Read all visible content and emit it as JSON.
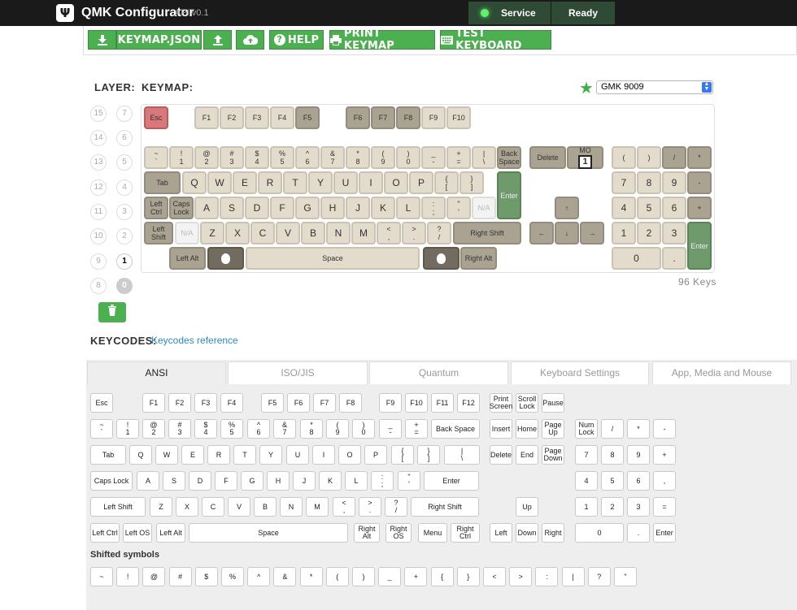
{
  "app": {
    "title": "QMK Configurator",
    "api": "API v0.1",
    "service": "Service",
    "status": "Ready"
  },
  "toolbar": {
    "keymap_json": "KEYMAP.JSON",
    "help": "HELP",
    "print": "PRINT KEYMAP",
    "test": "TEST KEYBOARD"
  },
  "labels": {
    "layer": "LAYER:",
    "keymap": "KEYMAP:",
    "keycodes": "KEYCODES:",
    "keycodes_link": "Keycodes reference",
    "keys_count": "96 Keys",
    "shifted": "Shifted symbols"
  },
  "colorway": {
    "selected": "GMK 9009"
  },
  "layers": [
    "15",
    "14",
    "13",
    "12",
    "11",
    "10",
    "9",
    "8",
    "7",
    "6",
    "5",
    "4",
    "3",
    "2",
    "1",
    "0"
  ],
  "keymap_keys": [
    {
      "t": "Esc",
      "c": "r"
    },
    {
      "t": "F1",
      "c": "a"
    },
    {
      "t": "F2",
      "c": "a"
    },
    {
      "t": "F3",
      "c": "a"
    },
    {
      "t": "F4",
      "c": "a"
    },
    {
      "t": "F5",
      "c": "m"
    },
    {
      "t": "F6",
      "c": "m"
    },
    {
      "t": "F7",
      "c": "m"
    },
    {
      "t": "F8",
      "c": "m"
    },
    {
      "t": "F9",
      "c": "a"
    },
    {
      "t": "F10",
      "c": "a"
    },
    {
      "t": "~",
      "s": "`",
      "c": "a"
    },
    {
      "t": "!",
      "s": "1",
      "c": "a"
    },
    {
      "t": "@",
      "s": "2",
      "c": "a"
    },
    {
      "t": "#",
      "s": "3",
      "c": "a"
    },
    {
      "t": "$",
      "s": "4",
      "c": "a"
    },
    {
      "t": "%",
      "s": "5",
      "c": "a"
    },
    {
      "t": "^",
      "s": "6",
      "c": "a"
    },
    {
      "t": "&",
      "s": "7",
      "c": "a"
    },
    {
      "t": "*",
      "s": "8",
      "c": "a"
    },
    {
      "t": "(",
      "s": "9",
      "c": "a"
    },
    {
      "t": ")",
      "s": "0",
      "c": "a"
    },
    {
      "t": "_",
      "s": "-",
      "c": "a"
    },
    {
      "t": "+",
      "s": "=",
      "c": "a"
    },
    {
      "t": "|",
      "s": "\\",
      "c": "a"
    },
    {
      "t": "Back",
      "s": "Space",
      "c": "m"
    },
    {
      "t": "Delete",
      "c": "m"
    },
    {
      "t": "MO",
      "s": "1",
      "c": "m",
      "mo": true
    },
    {
      "t": "(",
      "c": "a"
    },
    {
      "t": ")",
      "c": "a"
    },
    {
      "t": "/",
      "c": "m"
    },
    {
      "t": "*",
      "c": "m"
    },
    {
      "t": "Tab",
      "c": "m"
    },
    {
      "t": "Q",
      "c": "a",
      "b": 1
    },
    {
      "t": "W",
      "c": "a",
      "b": 1
    },
    {
      "t": "E",
      "c": "a",
      "b": 1
    },
    {
      "t": "R",
      "c": "a",
      "b": 1
    },
    {
      "t": "T",
      "c": "a",
      "b": 1
    },
    {
      "t": "Y",
      "c": "a",
      "b": 1
    },
    {
      "t": "U",
      "c": "a",
      "b": 1
    },
    {
      "t": "I",
      "c": "a",
      "b": 1
    },
    {
      "t": "O",
      "c": "a",
      "b": 1
    },
    {
      "t": "P",
      "c": "a",
      "b": 1
    },
    {
      "t": "{",
      "s": "[",
      "c": "a"
    },
    {
      "t": "}",
      "s": "]",
      "c": "a"
    },
    {
      "t": "Enter",
      "c": "g"
    },
    {
      "t": "7",
      "c": "a",
      "b": 1
    },
    {
      "t": "8",
      "c": "a",
      "b": 1
    },
    {
      "t": "9",
      "c": "a",
      "b": 1
    },
    {
      "t": "-",
      "c": "m",
      "b": 1
    },
    {
      "t": "Left",
      "s": "Ctrl",
      "c": "m"
    },
    {
      "t": "Caps",
      "s": "Lock",
      "c": "m"
    },
    {
      "t": "A",
      "c": "a",
      "b": 1
    },
    {
      "t": "S",
      "c": "a",
      "b": 1
    },
    {
      "t": "D",
      "c": "a",
      "b": 1
    },
    {
      "t": "F",
      "c": "a",
      "b": 1
    },
    {
      "t": "G",
      "c": "a",
      "b": 1
    },
    {
      "t": "H",
      "c": "a",
      "b": 1
    },
    {
      "t": "J",
      "c": "a",
      "b": 1
    },
    {
      "t": "K",
      "c": "a",
      "b": 1
    },
    {
      "t": "L",
      "c": "a",
      "b": 1
    },
    {
      "t": ":",
      "s": ";",
      "c": "a"
    },
    {
      "t": "\"",
      "s": "'",
      "c": "a"
    },
    {
      "t": "N/A",
      "c": "n"
    },
    {
      "t": "↑",
      "c": "m",
      "b": 1
    },
    {
      "t": "4",
      "c": "a",
      "b": 1
    },
    {
      "t": "5",
      "c": "a",
      "b": 1
    },
    {
      "t": "6",
      "c": "a",
      "b": 1
    },
    {
      "t": "+",
      "c": "m",
      "b": 1
    },
    {
      "t": "Left",
      "s": "Shift",
      "c": "m"
    },
    {
      "t": "N/A",
      "c": "n"
    },
    {
      "t": "Z",
      "c": "a",
      "b": 1
    },
    {
      "t": "X",
      "c": "a",
      "b": 1
    },
    {
      "t": "C",
      "c": "a",
      "b": 1
    },
    {
      "t": "V",
      "c": "a",
      "b": 1
    },
    {
      "t": "B",
      "c": "a",
      "b": 1
    },
    {
      "t": "N",
      "c": "a",
      "b": 1
    },
    {
      "t": "M",
      "c": "a",
      "b": 1
    },
    {
      "t": "<",
      "s": ",",
      "c": "a"
    },
    {
      "t": ">",
      "s": ".",
      "c": "a"
    },
    {
      "t": "?",
      "s": "/",
      "c": "a"
    },
    {
      "t": "Right Shift",
      "c": "m"
    },
    {
      "t": "←",
      "c": "m",
      "b": 1
    },
    {
      "t": "↓",
      "c": "m",
      "b": 1
    },
    {
      "t": "→",
      "c": "m",
      "b": 1
    },
    {
      "t": "1",
      "c": "a",
      "b": 1
    },
    {
      "t": "2",
      "c": "a",
      "b": 1
    },
    {
      "t": "3",
      "c": "a",
      "b": 1
    },
    {
      "t": "Enter",
      "c": "g"
    },
    {
      "t": "Left Alt",
      "c": "m"
    },
    {
      "t": "",
      "c": "d",
      "apple": true
    },
    {
      "t": "Space",
      "c": "a"
    },
    {
      "t": "",
      "c": "d",
      "apple": true
    },
    {
      "t": "Right Alt",
      "c": "m"
    },
    {
      "t": "0",
      "c": "a",
      "b": 1
    },
    {
      "t": ".",
      "c": "a",
      "b": 1
    }
  ],
  "tabs": [
    "ANSI",
    "ISO/JIS",
    "Quantum",
    "Keyboard Settings",
    "App, Media and Mouse"
  ],
  "keycodes": [
    {
      "t": "Esc"
    },
    {
      "t": "F1"
    },
    {
      "t": "F2"
    },
    {
      "t": "F3"
    },
    {
      "t": "F4"
    },
    {
      "t": "F5"
    },
    {
      "t": "F6"
    },
    {
      "t": "F7"
    },
    {
      "t": "F8"
    },
    {
      "t": "F9"
    },
    {
      "t": "F10"
    },
    {
      "t": "F11"
    },
    {
      "t": "F12"
    },
    {
      "t": "Print",
      "s": "Screen"
    },
    {
      "t": "Scroll",
      "s": "Lock"
    },
    {
      "t": "Pause"
    },
    {
      "t": "~",
      "s": "`"
    },
    {
      "t": "!",
      "s": "1"
    },
    {
      "t": "@",
      "s": "2"
    },
    {
      "t": "#",
      "s": "3"
    },
    {
      "t": "$",
      "s": "4"
    },
    {
      "t": "%",
      "s": "5"
    },
    {
      "t": "^",
      "s": "6"
    },
    {
      "t": "&",
      "s": "7"
    },
    {
      "t": "*",
      "s": "8"
    },
    {
      "t": "(",
      "s": "9"
    },
    {
      "t": ")",
      "s": "0"
    },
    {
      "t": "_",
      "s": "-"
    },
    {
      "t": "+",
      "s": "="
    },
    {
      "t": "Back Space"
    },
    {
      "t": "Insert"
    },
    {
      "t": "Home"
    },
    {
      "t": "Page",
      "s": "Up"
    },
    {
      "t": "Num",
      "s": "Lock"
    },
    {
      "t": "/"
    },
    {
      "t": "*"
    },
    {
      "t": "-"
    },
    {
      "t": "Tab"
    },
    {
      "t": "Q"
    },
    {
      "t": "W"
    },
    {
      "t": "E"
    },
    {
      "t": "R"
    },
    {
      "t": "T"
    },
    {
      "t": "Y"
    },
    {
      "t": "U"
    },
    {
      "t": "I"
    },
    {
      "t": "O"
    },
    {
      "t": "P"
    },
    {
      "t": "{",
      "s": "["
    },
    {
      "t": "}",
      "s": "]"
    },
    {
      "t": "|",
      "s": "\\"
    },
    {
      "t": "Delete"
    },
    {
      "t": "End"
    },
    {
      "t": "Page",
      "s": "Down"
    },
    {
      "t": "7"
    },
    {
      "t": "8"
    },
    {
      "t": "9"
    },
    {
      "t": "+"
    },
    {
      "t": "Caps Lock"
    },
    {
      "t": "A"
    },
    {
      "t": "S"
    },
    {
      "t": "D"
    },
    {
      "t": "F"
    },
    {
      "t": "G"
    },
    {
      "t": "H"
    },
    {
      "t": "J"
    },
    {
      "t": "K"
    },
    {
      "t": "L"
    },
    {
      "t": ":",
      "s": ";"
    },
    {
      "t": "\"",
      "s": "'"
    },
    {
      "t": "Enter"
    },
    {
      "t": "4"
    },
    {
      "t": "5"
    },
    {
      "t": "6"
    },
    {
      "t": ","
    },
    {
      "t": "Left Shift"
    },
    {
      "t": "Z"
    },
    {
      "t": "X"
    },
    {
      "t": "C"
    },
    {
      "t": "V"
    },
    {
      "t": "B"
    },
    {
      "t": "N"
    },
    {
      "t": "M"
    },
    {
      "t": "<",
      "s": ","
    },
    {
      "t": ">",
      "s": "."
    },
    {
      "t": "?",
      "s": "/"
    },
    {
      "t": "Right Shift"
    },
    {
      "t": "Up"
    },
    {
      "t": "1"
    },
    {
      "t": "2"
    },
    {
      "t": "3"
    },
    {
      "t": "="
    },
    {
      "t": "Left Ctrl"
    },
    {
      "t": "Left OS"
    },
    {
      "t": "Left Alt"
    },
    {
      "t": "Space"
    },
    {
      "t": "Right",
      "s": "Alt"
    },
    {
      "t": "Right",
      "s": "OS"
    },
    {
      "t": "Menu"
    },
    {
      "t": "Right",
      "s": "Ctrl"
    },
    {
      "t": "Left"
    },
    {
      "t": "Down"
    },
    {
      "t": "Right"
    },
    {
      "t": "0"
    },
    {
      "t": "."
    },
    {
      "t": "Enter"
    }
  ],
  "shifted_symbols": [
    "~",
    "!",
    "@",
    "#",
    "$",
    "%",
    "^",
    "&",
    "*",
    "(",
    ")",
    "_",
    "+",
    "{",
    "}",
    "<",
    ">",
    ":",
    "|",
    "?",
    "\""
  ],
  "colors": {
    "accent": "#4caf50",
    "topbar": "#1a1a1a",
    "link": "#2b8ac7"
  }
}
